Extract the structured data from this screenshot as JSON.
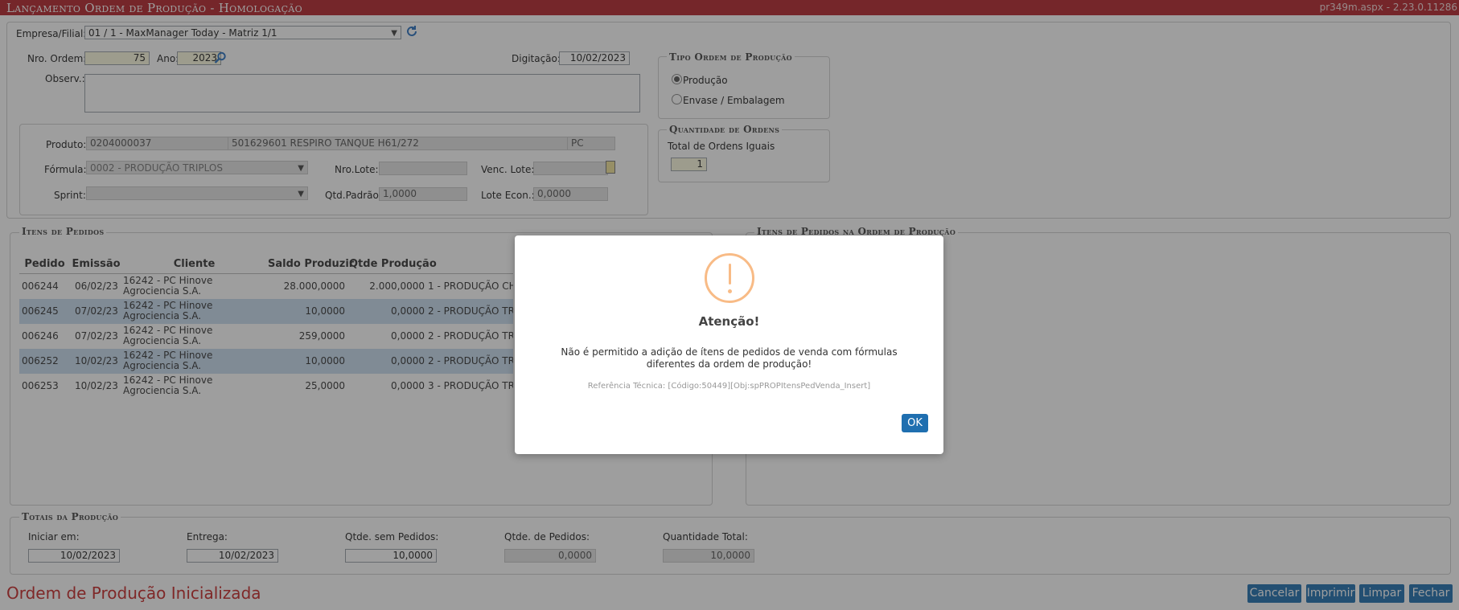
{
  "window": {
    "title": "Lançamento Ordem de Produção  - Homologação",
    "version": "pr349m.aspx - 2.23.0.11286"
  },
  "header": {
    "empresa_label": "Empresa/Filial:",
    "empresa_value": "01 / 1 - MaxManager Today - Matriz 1/1",
    "nro_ordem_label": "Nro. Ordem:",
    "nro_ordem_value": "75",
    "ano_label": "Ano:",
    "ano_value": "2023",
    "digitacao_label": "Digitação:",
    "digitacao_value": "10/02/2023",
    "observ_label": "Observ.:",
    "observ_value": ""
  },
  "tipo_ordem": {
    "legend": "Tipo Ordem de Produção",
    "options": [
      "Produção",
      "Envase / Embalagem"
    ]
  },
  "quantidade_ordens": {
    "legend": "Quantidade de Ordens",
    "label": "Total de Ordens Iguais",
    "value": "1"
  },
  "produto": {
    "produto_label": "Produto:",
    "codigo": "0204000037",
    "descricao": "501629601 RESPIRO TANQUE H61/272",
    "unidade": "PC",
    "formula_label": "Fórmula:",
    "formula_value": "0002 - PRODUÇÃO TRIPLOS",
    "nro_lote_label": "Nro.Lote:",
    "nro_lote_value": "",
    "venc_lote_label": "Venc. Lote:",
    "venc_lote_value": "",
    "sprint_label": "Sprint:",
    "sprint_value": "",
    "qtd_padrao_label": "Qtd.Padrão:",
    "qtd_padrao_value": "1,0000",
    "lote_econ_label": "Lote Econ.:",
    "lote_econ_value": "0,0000"
  },
  "itens_pedidos": {
    "legend": "Itens de Pedidos",
    "columns": [
      "Pedido",
      "Emissão",
      "Cliente",
      "Saldo Produzir",
      "Qtde Produção"
    ],
    "rows": [
      {
        "pedido": "006244",
        "emissao": "06/02/23",
        "cliente": "16242 - PC Hinove Agrociencia S.A.",
        "saldo": "28.000,0000",
        "qtde": "2.000,0000",
        "formula": "1 - PRODUÇÃO CHA"
      },
      {
        "pedido": "006245",
        "emissao": "07/02/23",
        "cliente": "16242 - PC Hinove Agrociencia S.A.",
        "saldo": "10,0000",
        "qtde": "0,0000",
        "formula": "2 - PRODUÇÃO TRI"
      },
      {
        "pedido": "006246",
        "emissao": "07/02/23",
        "cliente": "16242 - PC Hinove Agrociencia S.A.",
        "saldo": "259,0000",
        "qtde": "0,0000",
        "formula": "2 - PRODUÇÃO TRI"
      },
      {
        "pedido": "006252",
        "emissao": "10/02/23",
        "cliente": "16242 - PC Hinove Agrociencia S.A.",
        "saldo": "10,0000",
        "qtde": "0,0000",
        "formula": "2 - PRODUÇÃO TRI"
      },
      {
        "pedido": "006253",
        "emissao": "10/02/23",
        "cliente": "16242 - PC Hinove Agrociencia S.A.",
        "saldo": "25,0000",
        "qtde": "0,0000",
        "formula": "3 - PRODUÇÃO TRI"
      }
    ]
  },
  "itens_ordem": {
    "legend": "Itens de Pedidos na Ordem de Produção"
  },
  "totais": {
    "legend": "Totais da Produção",
    "iniciar_label": "Iniciar em:",
    "iniciar_value": "10/02/2023",
    "entrega_label": "Entrega:",
    "entrega_value": "10/02/2023",
    "sem_pedidos_label": "Qtde. sem Pedidos:",
    "sem_pedidos_value": "10,0000",
    "de_pedidos_label": "Qtde. de Pedidos:",
    "de_pedidos_value": "0,0000",
    "total_label": "Quantidade Total:",
    "total_value": "10,0000"
  },
  "status": {
    "text": "Ordem de Produção Inicializada"
  },
  "buttons": {
    "cancelar": "Cancelar",
    "imprimir": "Imprimir",
    "limpar": "Limpar",
    "fechar": "Fechar"
  },
  "modal": {
    "title": "Atenção!",
    "message": "Não é permitido a adição de ítens de pedidos de venda com fórmulas diferentes da ordem de produção!",
    "reference": "Referência Técnica: [Código:50449][Obj:spPROPItensPedVenda_Insert]",
    "ok": "OK"
  },
  "colors": {
    "titlebar": "#b5262d",
    "accent_button": "#1f6fb0",
    "status_text": "#c62828",
    "warning_icon": "#f8bb86",
    "selected_row": "#c9dcef"
  }
}
